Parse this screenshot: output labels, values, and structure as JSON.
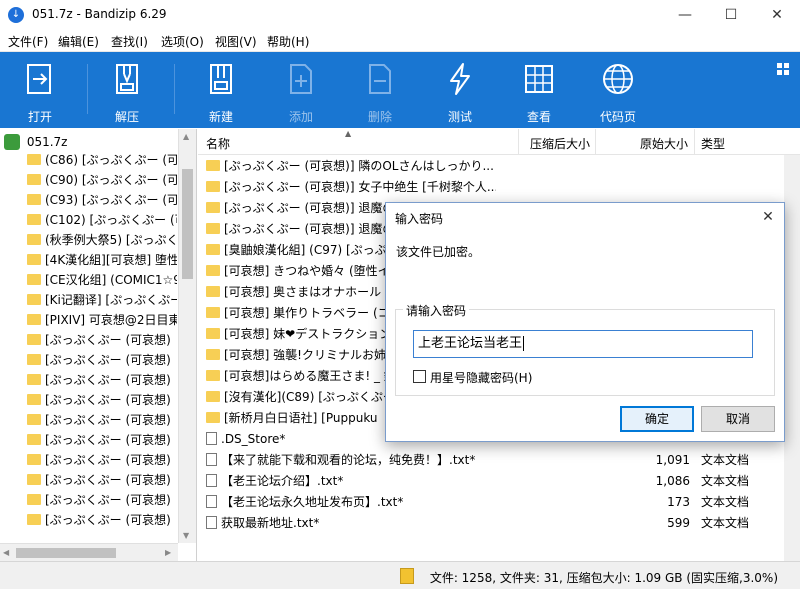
{
  "window": {
    "title": "051.7z - Bandizip 6.29",
    "minimize": "—",
    "maximize": "☐",
    "close": "✕"
  },
  "menu": [
    "文件(F)",
    "编辑(E)",
    "查找(I)",
    "选项(O)",
    "视图(V)",
    "帮助(H)"
  ],
  "toolbar": {
    "open": "打开",
    "extract": "解压",
    "new": "新建",
    "add": "添加",
    "delete": "删除",
    "test": "测试",
    "view": "查看",
    "codepage": "代码页"
  },
  "tree": {
    "root": "051.7z",
    "items": [
      "(C86) [ぷっぷくぷー (可哀",
      "(C90) [ぷっぷくぷー (可哀",
      "(C93) [ぷっぷくぷー (可哀",
      "(C102) [ぷっぷくぷー (可哀",
      "(秋季例大祭5) [ぷっぷく",
      "[4K漢化組][可哀想] 堕性",
      "[CE汉化组] (COMIC1☆9",
      "[Ki记翻译] [ぷっぷくぷー",
      "[PIXIV] 可哀想@2日目東",
      "[ぷっぷくぷー (可哀想)",
      "[ぷっぷくぷー (可哀想)",
      "[ぷっぷくぷー (可哀想)",
      "[ぷっぷくぷー (可哀想)",
      "[ぷっぷくぷー (可哀想)",
      "[ぷっぷくぷー (可哀想)",
      "[ぷっぷくぷー (可哀想)",
      "[ぷっぷくぷー (可哀想)",
      "[ぷっぷくぷー (可哀想)",
      "[ぷっぷくぷー (可哀想)"
    ]
  },
  "columns": {
    "name": "名称",
    "packed": "压缩后大小",
    "original": "原始大小",
    "type": "类型"
  },
  "files": [
    {
      "name": "[ぷっぷくぷー (可哀想)] 隣のOLさんはしっかり..."
    },
    {
      "name": "[ぷっぷくぷー (可哀想)] 女子中绝生 [千树黎个人..."
    },
    {
      "name": "[ぷっぷくぷー (可哀想)] 退魔の"
    },
    {
      "name": "[ぷっぷくぷー (可哀想)] 退魔の"
    },
    {
      "name": "[臭鼬娘漢化組] (C97) [ぷっぷく"
    },
    {
      "name": "[可哀想] きつねや婚々 (堕性イ"
    },
    {
      "name": "[可哀想] 奥さまはオナホール ("
    },
    {
      "name": "[可哀想] 巣作りトラベラー (コ"
    },
    {
      "name": "[可哀想] 妹❤デストラクション"
    },
    {
      "name": "[可哀想] 強襲!クリミナルお姉"
    },
    {
      "name": "[可哀想]はらめる魔王さま! _ 鍵"
    },
    {
      "name": "[沒有漢化](C89) [ぷっぷくぷー"
    },
    {
      "name": "[新桥月白日语社] [Puppuku"
    },
    {
      "name": ".DS_Store*"
    },
    {
      "name": "【来了就能下载和观看的论坛，纯免费！】.txt*",
      "original": "1,091",
      "type": "文本文档"
    },
    {
      "name": "【老王论坛介绍】.txt*",
      "original": "1,086",
      "type": "文本文档"
    },
    {
      "name": "【老王论坛永久地址发布页】.txt*",
      "original": "173",
      "type": "文本文档"
    },
    {
      "name": "获取最新地址.txt*",
      "original": "599",
      "type": "文本文档"
    }
  ],
  "status": "文件: 1258, 文件夹: 31, 压缩包大小: 1.09 GB (固实压缩,3.0%)",
  "dialog": {
    "title": "输入密码",
    "message": "该文件已加密。",
    "group_label": "请输入密码",
    "password_value": "上老王论坛当老王",
    "checkbox_label": "用星号隐藏密码(H)",
    "ok": "确定",
    "cancel": "取消",
    "close": "✕"
  },
  "colors": {
    "toolbar_bg": "#1976d2",
    "folder": "#f7cf55",
    "accent": "#0078d7"
  }
}
